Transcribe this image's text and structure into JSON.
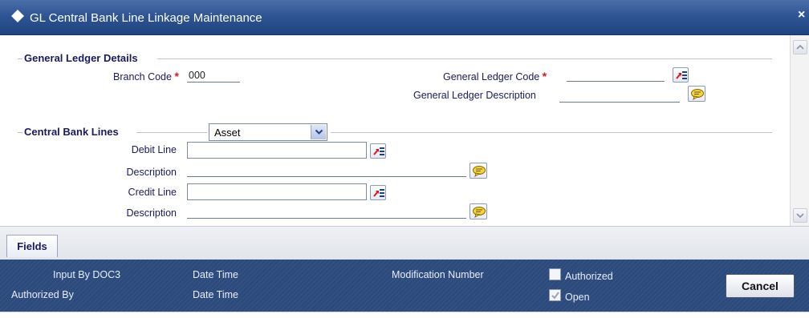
{
  "window": {
    "title": "GL Central Bank Line Linkage Maintenance",
    "close_glyph": "×",
    "icon": "diamond-icon"
  },
  "general_ledger_details": {
    "section_title": "General Ledger Details",
    "branch_code_label": "Branch Code",
    "branch_code_value": "000",
    "gl_code_label": "General Ledger Code",
    "gl_code_value": "",
    "gl_description_label": "General Ledger Description",
    "gl_description_value": "",
    "required_marker": "*"
  },
  "central_bank_lines": {
    "section_title": "Central Bank Lines",
    "type_selected": "Asset",
    "debit_line_label": "Debit Line",
    "debit_line_value": "",
    "debit_description_label": "Description",
    "debit_description_value": "",
    "credit_line_label": "Credit Line",
    "credit_line_value": "",
    "credit_description_label": "Description",
    "credit_description_value": ""
  },
  "tabs": {
    "fields_label": "Fields"
  },
  "footer": {
    "input_by_label": "Input By DOC3",
    "authorized_by_label": "Authorized By",
    "date_time_label_1": "Date Time",
    "date_time_label_2": "Date Time",
    "modification_number_label": "Modification Number",
    "authorized_checkbox_label": "Authorized",
    "authorized_checked": false,
    "open_checkbox_label": "Open",
    "open_checked": true,
    "cancel_label": "Cancel"
  },
  "colors": {
    "titlebar": "#2f5594",
    "footer": "#2c4a7c",
    "required": "#e0131b",
    "label_text": "#1a1a5e"
  }
}
